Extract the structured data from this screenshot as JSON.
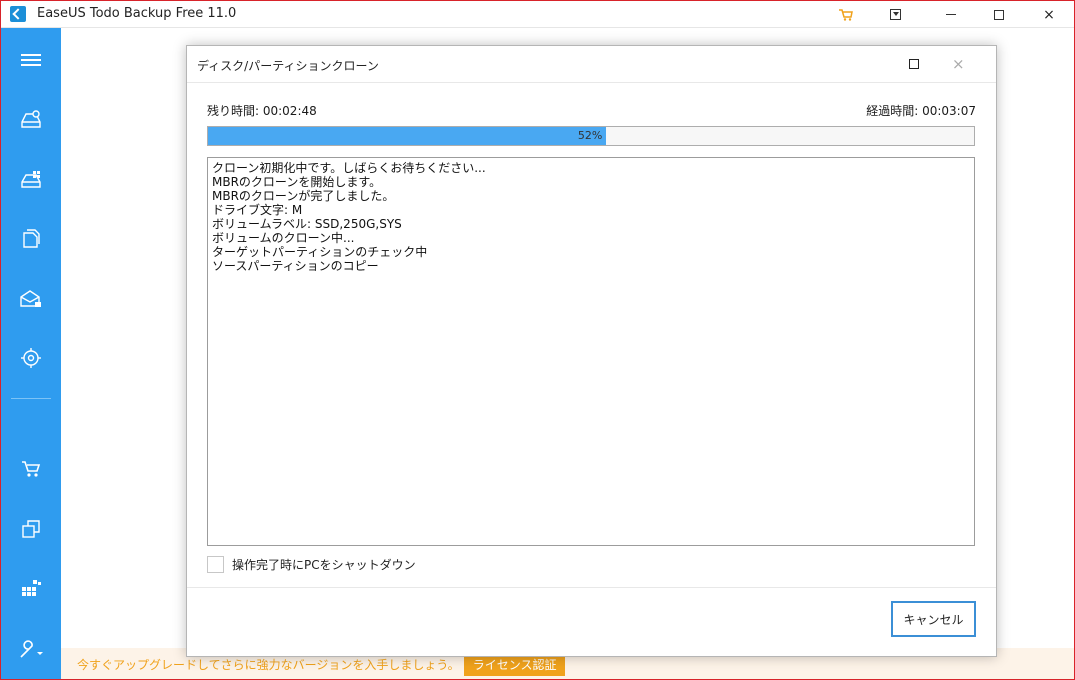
{
  "app": {
    "title": "EaseUS Todo Backup Free 11.0"
  },
  "titlebar_buttons": {
    "cart_icon": "cart-icon",
    "menu_icon": "dropdown-menu-icon",
    "minimize": "minimize-icon",
    "maximize": "maximize-icon",
    "close": "×"
  },
  "sidebar": {
    "items": [
      {
        "icon": "hamburger-menu-icon"
      },
      {
        "icon": "disk-backup-icon"
      },
      {
        "icon": "system-backup-icon"
      },
      {
        "icon": "file-backup-icon"
      },
      {
        "icon": "mail-backup-icon"
      },
      {
        "icon": "smart-backup-icon"
      },
      {
        "icon": "cart-icon"
      },
      {
        "icon": "clone-icon"
      },
      {
        "icon": "tools-grid-icon"
      },
      {
        "icon": "wrench-icon"
      }
    ],
    "color": "#2f9cef"
  },
  "banner": {
    "text": "今すぐアップグレードしてさらに強力なバージョンを入手しましょう。",
    "license_button": "ライセンス認証",
    "accent": "#f0a21c"
  },
  "dialog": {
    "title": "ディスク/パーティションクローン",
    "close": "×",
    "remaining_label": "残り時間: 00:02:48",
    "elapsed_label": "経過時間: 00:03:07",
    "progress": {
      "percent": 52,
      "label": "52%",
      "color": "#49a8f2"
    },
    "log": [
      "クローン初期化中です。しばらくお待ちください...",
      "MBRのクローンを開始します。",
      "MBRのクローンが完了しました。",
      "ドライブ文字: M",
      "ボリュームラベル: SSD,250G,SYS",
      "ボリュームのクローン中...",
      "ターゲットパーティションのチェック中",
      "ソースパーティションのコピー"
    ],
    "shutdown_checkbox": "操作完了時にPCをシャットダウン",
    "cancel_button": "キャンセル"
  }
}
